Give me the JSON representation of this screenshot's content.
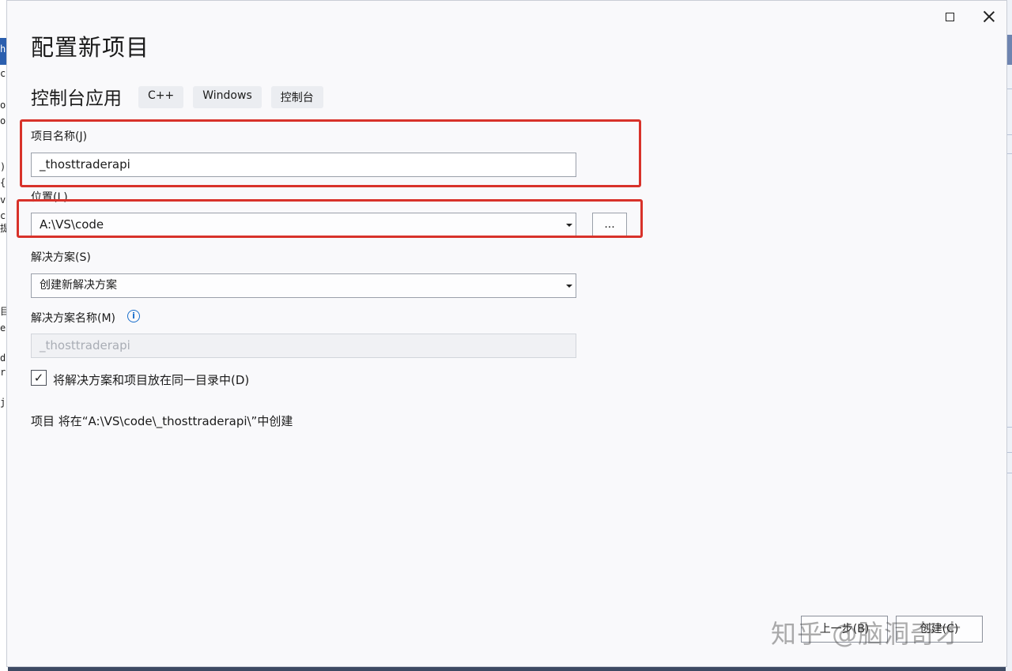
{
  "dialog": {
    "title": "配置新项目",
    "template_name": "控制台应用",
    "tags": [
      "C++",
      "Windows",
      "控制台"
    ]
  },
  "project_name": {
    "label": "项目名称(J)",
    "value": "_thosttraderapi"
  },
  "location": {
    "label": "位置(L)",
    "value": "A:\\VS\\code",
    "browse_label": "..."
  },
  "solution": {
    "label": "解决方案(S)",
    "value": "创建新解决方案"
  },
  "solution_name": {
    "label": "解决方案名称(M)",
    "info_icon": "i",
    "value": "_thosttraderapi"
  },
  "same_dir": {
    "checked_mark": "✓",
    "label": "将解决方案和项目放在同一目录中(D)"
  },
  "path_note": "项目 将在“A:\\VS\\code\\_thosttraderapi\\”中创建",
  "buttons": {
    "back": "上一步(B)",
    "create": "创建(C)"
  },
  "watermark": "知乎 @脑洞奇才",
  "icons": {
    "maximize": "maximize-icon",
    "close": "close-icon",
    "info": "info-icon",
    "dropdown": "chevron-down-icon"
  },
  "annotation_color": "#d8322a",
  "background_code": [
    "h",
    "c",
    "o",
    "o",
    ")",
    "{",
    "v",
    "c",
    "提",
    "目",
    "e",
    "d",
    "r",
    "j"
  ]
}
